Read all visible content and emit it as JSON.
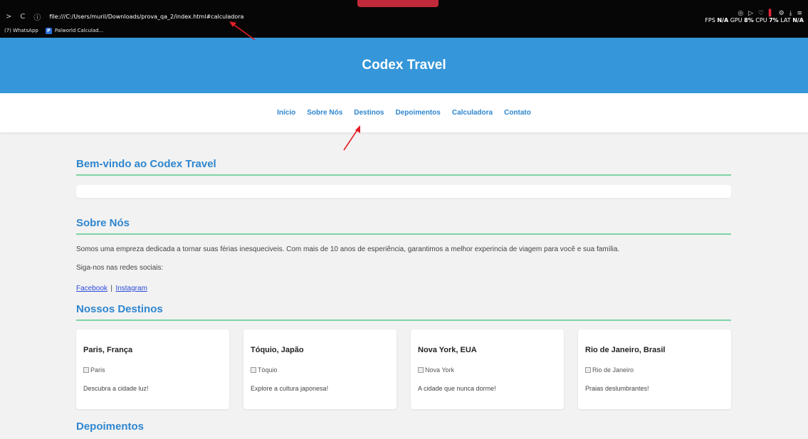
{
  "browser": {
    "nav_back": ">",
    "nav_reload": "C",
    "nav_info": "ⓘ",
    "url": "file:///C:/Users/muril/Downloads/prova_qa_2/index.html#calculadora",
    "bookmarks": [
      {
        "label": "(7) WhatsApp"
      },
      {
        "label": "Palworld Calculad..."
      }
    ],
    "perf_line1_label_fps": "FPS",
    "perf_line1_val_fps": "N/A",
    "perf_line1_label_gpu": "GPU",
    "perf_line1_val_gpu": "8%",
    "perf_line1_label_cpu": "CPU",
    "perf_line1_val_cpu": "7%",
    "perf_line1_label_lat": "LAT",
    "perf_line1_val_lat": "N/A",
    "accent_color": "#c12a3a"
  },
  "header": {
    "title": "Codex Travel",
    "bg_color": "#3596d9"
  },
  "nav": {
    "items": [
      {
        "label": "Início"
      },
      {
        "label": "Sobre Nós"
      },
      {
        "label": "Destinos"
      },
      {
        "label": "Depoimentos"
      },
      {
        "label": "Calculadora"
      },
      {
        "label": "Contato"
      }
    ]
  },
  "welcome": {
    "title": "Bem-vindo ao Codex Travel"
  },
  "about": {
    "title": "Sobre Nós",
    "paragraph": "Somos uma empreza dedicada a tornar suas férias inesqueciveis. Com mais de 10 anos de esperiência, garantimos a melhor experincia de viagem para você e sua família.",
    "social_label": "Siga-nos nas redes sociais:",
    "facebook": "Facebook",
    "separator": "|",
    "instagram": "Instagram"
  },
  "destinations": {
    "title": "Nossos Destinos",
    "cards": [
      {
        "title": "Paris, França",
        "img_alt": "Paris",
        "text": "Descubra a cidade luz!"
      },
      {
        "title": "Tóquio, Japão",
        "img_alt": "Tóquio",
        "text": "Explore a cultura japonesa!"
      },
      {
        "title": "Nova York, EUA",
        "img_alt": "Nova York",
        "text": "A cidade que nunca dorme!"
      },
      {
        "title": "Rio de Janeiro, Brasil",
        "img_alt": "Rio de Janeiro",
        "text": "Praias deslumbrantes!"
      }
    ]
  },
  "testimonials": {
    "title": "Depoimentos"
  },
  "colors": {
    "link_blue": "#2e86cf",
    "underline_green": "#7fd3a7",
    "annotation_red": "#e41e26"
  }
}
